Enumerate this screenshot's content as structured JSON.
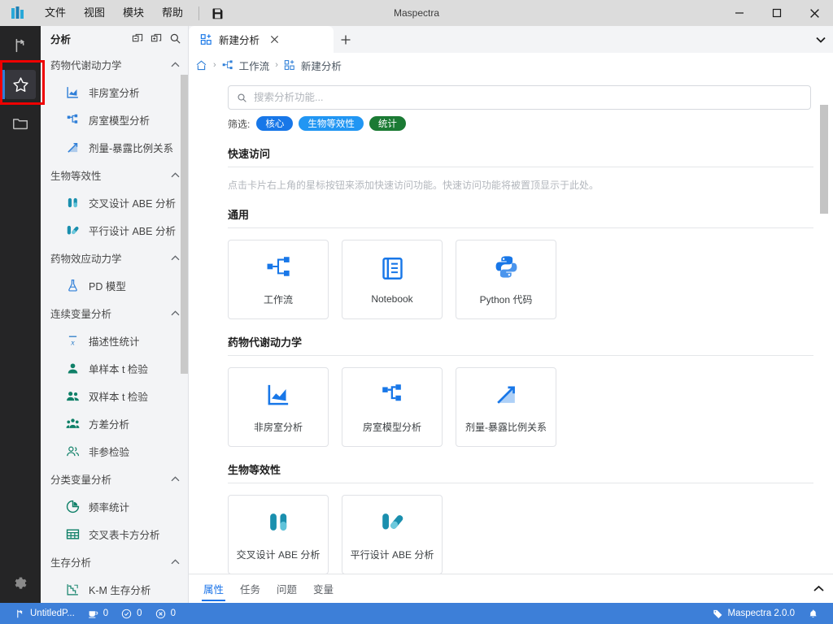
{
  "window": {
    "title": "Maspectra",
    "logo_icon": "maspectra-logo-icon",
    "minimize_label": "–",
    "maximize_label": "☐",
    "close_label": "✕"
  },
  "menubar": {
    "items": [
      {
        "label": "文件",
        "name": "menu-file"
      },
      {
        "label": "视图",
        "name": "menu-view"
      },
      {
        "label": "模块",
        "name": "menu-module"
      },
      {
        "label": "帮助",
        "name": "menu-help"
      }
    ],
    "save_icon": "save-disk-icon"
  },
  "activitybar": {
    "items": [
      {
        "name": "activity-workflow",
        "icon": "workflow-branch-icon",
        "active": false
      },
      {
        "name": "activity-favorites",
        "icon": "star-icon",
        "active": true
      },
      {
        "name": "activity-files",
        "icon": "folder-icon",
        "active": false
      }
    ],
    "settings": {
      "name": "activity-settings",
      "icon": "gear-icon"
    },
    "accent_color": "#2f7fd8",
    "highlight_color": "#ef0000"
  },
  "sidebar": {
    "title": "分析",
    "actions": [
      {
        "name": "collapse-all-icon",
        "icon": "collapse-all-icon"
      },
      {
        "name": "expand-all-icon",
        "icon": "expand-all-icon"
      },
      {
        "name": "search-icon",
        "icon": "search-icon"
      }
    ],
    "groups": [
      {
        "label": "药物代谢动力学",
        "name": "sidebar-group-pharmacokinetics",
        "expanded": true,
        "items": [
          {
            "label": "非房室分析",
            "icon": "area-chart-icon",
            "name": "sidebar-item-nca",
            "color": "#2f7fd8"
          },
          {
            "label": "房室模型分析",
            "icon": "compartment-model-icon",
            "name": "sidebar-item-compartment",
            "color": "#2f7fd8"
          },
          {
            "label": "剂量-暴露比例关系",
            "icon": "dose-proportionality-icon",
            "name": "sidebar-item-dose-proportionality",
            "color": "#2f7fd8"
          }
        ]
      },
      {
        "label": "生物等效性",
        "name": "sidebar-group-bioequivalence",
        "expanded": true,
        "items": [
          {
            "label": "交叉设计 ABE 分析",
            "icon": "two-capsules-icon",
            "name": "sidebar-item-crossover-abe",
            "color": "#1a8fae"
          },
          {
            "label": "平行设计 ABE 分析",
            "icon": "parallel-capsules-icon",
            "name": "sidebar-item-parallel-abe",
            "color": "#1a8fae"
          }
        ]
      },
      {
        "label": "药物效应动力学",
        "name": "sidebar-group-pharmacodynamics",
        "expanded": true,
        "items": [
          {
            "label": "PD 模型",
            "icon": "flask-icon",
            "name": "sidebar-item-pd-model",
            "color": "#2f7fd8"
          }
        ]
      },
      {
        "label": "连续变量分析",
        "name": "sidebar-group-continuous-variables",
        "expanded": true,
        "items": [
          {
            "label": "描述性统计",
            "icon": "x-bar-icon",
            "name": "sidebar-item-descriptive-statistics",
            "color": "#1b73c4"
          },
          {
            "label": "单样本 t 检验",
            "icon": "single-person-icon",
            "name": "sidebar-item-one-sample-t-test",
            "color": "#0f8068"
          },
          {
            "label": "双样本 t 检验",
            "icon": "two-persons-icon",
            "name": "sidebar-item-two-sample-t-test",
            "color": "#0f8068"
          },
          {
            "label": "方差分析",
            "icon": "three-persons-icon",
            "name": "sidebar-item-anova",
            "color": "#0f8068"
          },
          {
            "label": "非参检验",
            "icon": "people-outline-icon",
            "name": "sidebar-item-nonparametric",
            "color": "#0f8068"
          }
        ]
      },
      {
        "label": "分类变量分析",
        "name": "sidebar-group-categorical-variables",
        "expanded": true,
        "items": [
          {
            "label": "频率统计",
            "icon": "pie-chart-icon",
            "name": "sidebar-item-frequency",
            "color": "#0f8068"
          },
          {
            "label": "交叉表卡方分析",
            "icon": "table-icon",
            "name": "sidebar-item-crosstab-chisq",
            "color": "#0f8068"
          }
        ]
      },
      {
        "label": "生存分析",
        "name": "sidebar-group-survival",
        "expanded": true,
        "items": [
          {
            "label": "K-M 生存分析",
            "icon": "survival-curve-icon",
            "name": "sidebar-item-km-survival",
            "color": "#0f8068"
          }
        ]
      }
    ]
  },
  "tabbar": {
    "tabs": [
      {
        "label": "新建分析",
        "icon": "new-analysis-icon",
        "active": true,
        "name": "tab-new-analysis"
      }
    ],
    "close_label": "✕",
    "new_tab_label": "+",
    "more_label": "▾"
  },
  "breadcrumb": {
    "items": [
      {
        "label": "",
        "icon": "home-icon",
        "name": "breadcrumb-home"
      },
      {
        "label": "工作流",
        "icon": "workflow-icon",
        "name": "breadcrumb-workflow"
      },
      {
        "label": "新建分析",
        "icon": "new-analysis-icon",
        "name": "breadcrumb-new-analysis"
      }
    ],
    "separator": "›"
  },
  "search": {
    "placeholder": "搜索分析功能...",
    "value": "",
    "icon": "search-icon"
  },
  "filters": {
    "label": "筛选:",
    "chips": [
      {
        "label": "核心",
        "color": "#1877e8",
        "name": "filter-chip-core"
      },
      {
        "label": "生物等效性",
        "color": "#2196f3",
        "name": "filter-chip-bioequivalence"
      },
      {
        "label": "统计",
        "color": "#1b7a34",
        "name": "filter-chip-statistics"
      }
    ]
  },
  "sections": [
    {
      "title": "快速访问",
      "name": "section-quick-access",
      "note": "点击卡片右上角的星标按钮来添加快速访问功能。快速访问功能将被置顶显示于此处。",
      "cards": []
    },
    {
      "title": "通用",
      "name": "section-general",
      "note": "",
      "cards": [
        {
          "label": "工作流",
          "icon": "workflow-icon",
          "name": "card-workflow",
          "color": "#1877e8"
        },
        {
          "label": "Notebook",
          "icon": "notebook-icon",
          "name": "card-notebook",
          "color": "#1877e8"
        },
        {
          "label": "Python 代码",
          "icon": "python-icon",
          "name": "card-python-code",
          "color": "#1877e8"
        }
      ]
    },
    {
      "title": "药物代谢动力学",
      "name": "section-pharmacokinetics",
      "note": "",
      "cards": [
        {
          "label": "非房室分析",
          "icon": "area-chart-icon",
          "name": "card-nca",
          "color": "#1877e8"
        },
        {
          "label": "房室模型分析",
          "icon": "compartment-model-icon",
          "name": "card-compartment",
          "color": "#1877e8"
        },
        {
          "label": "剂量-暴露比例关系",
          "icon": "dose-proportionality-icon",
          "name": "card-dose-proportionality",
          "color": "#1877e8"
        }
      ]
    },
    {
      "title": "生物等效性",
      "name": "section-bioequivalence",
      "note": "",
      "cards": [
        {
          "label": "交叉设计 ABE 分析",
          "icon": "two-capsules-icon",
          "name": "card-crossover-abe",
          "color": "#1a8fae"
        },
        {
          "label": "平行设计 ABE 分析",
          "icon": "parallel-capsules-icon",
          "name": "card-parallel-abe",
          "color": "#1a8fae"
        }
      ]
    }
  ],
  "panel": {
    "tabs": [
      {
        "label": "属性",
        "active": true,
        "name": "panel-tab-properties"
      },
      {
        "label": "任务",
        "active": false,
        "name": "panel-tab-tasks"
      },
      {
        "label": "问题",
        "active": false,
        "name": "panel-tab-problems"
      },
      {
        "label": "变量",
        "active": false,
        "name": "panel-tab-variables"
      }
    ],
    "collapse_icon": "chevron-up-icon"
  },
  "statusbar": {
    "project": "UntitledP...",
    "project_icon": "workflow-branch-icon",
    "metrics": [
      {
        "icon": "kernel-icon",
        "value": "0",
        "name": "status-kernel-count"
      },
      {
        "icon": "check-circle-icon",
        "value": "0",
        "name": "status-success-count"
      },
      {
        "icon": "error-circle-icon",
        "value": "0",
        "name": "status-error-count"
      }
    ],
    "version": "Maspectra 2.0.0",
    "version_icon": "tag-icon",
    "bell_icon": "bell-icon",
    "background_color": "#3d7fd8"
  }
}
